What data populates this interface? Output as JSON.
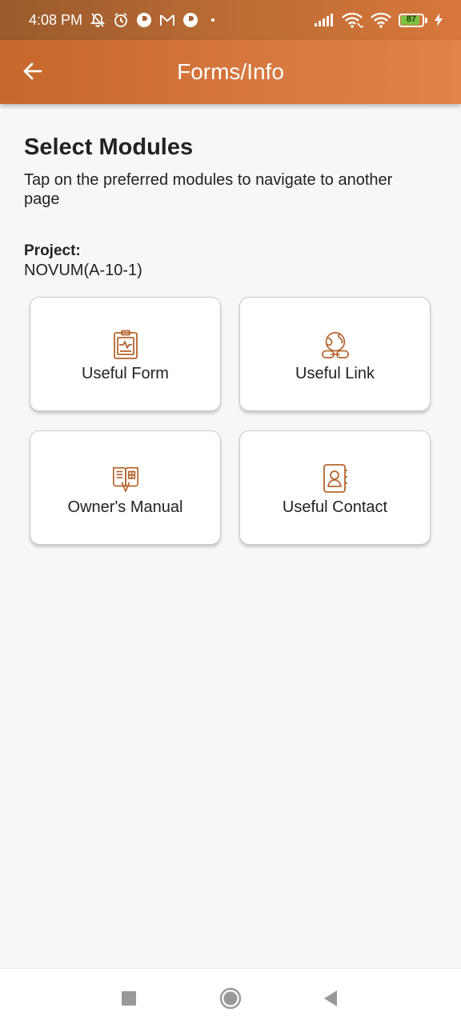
{
  "status_bar": {
    "time": "4:08 PM",
    "battery": "87",
    "icons": [
      "mute-icon",
      "alarm-icon",
      "app-notification-icon",
      "gmail-icon",
      "app-notification-icon",
      "dot-icon",
      "signal-icon",
      "wifi-calling-icon",
      "wifi-icon",
      "battery-icon",
      "charging-icon"
    ]
  },
  "app_bar": {
    "title": "Forms/Info",
    "back_icon": "arrow-left-icon"
  },
  "page": {
    "title": "Select Modules",
    "subtitle": "Tap on the preferred modules to navigate to another page",
    "project_label": "Project:",
    "project_value": "NOVUM(A-10-1)"
  },
  "modules": [
    {
      "label": "Useful Form",
      "icon": "clipboard-form-icon"
    },
    {
      "label": "Useful Link",
      "icon": "globe-link-icon"
    },
    {
      "label": "Owner's Manual",
      "icon": "open-book-manual-icon"
    },
    {
      "label": "Useful Contact",
      "icon": "contact-book-icon"
    }
  ],
  "colors": {
    "accent": "#D6773E",
    "icon": "#B5642F",
    "status_bar": "#A55E2E"
  },
  "nav_bar": [
    "recents-square-icon",
    "home-circle-icon",
    "back-triangle-icon"
  ]
}
